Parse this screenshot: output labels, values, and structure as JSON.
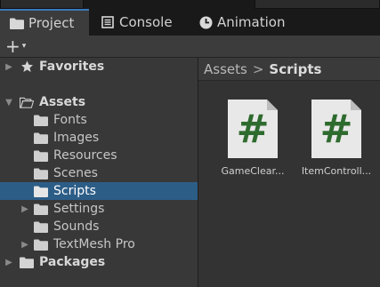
{
  "tabs": [
    {
      "label": "Project",
      "icon": "folder-icon",
      "active": true
    },
    {
      "label": "Console",
      "icon": "console-icon",
      "active": false
    },
    {
      "label": "Animation",
      "icon": "clock-icon",
      "active": false
    }
  ],
  "toolbar": {
    "add_label": "+",
    "add_caret": "▾"
  },
  "tree": {
    "favorites": "Favorites",
    "assets": "Assets",
    "fonts": "Fonts",
    "images": "Images",
    "resources": "Resources",
    "scenes": "Scenes",
    "scripts": "Scripts",
    "settings": "Settings",
    "sounds": "Sounds",
    "textmeshpro": "TextMesh Pro",
    "packages": "Packages",
    "selected": "Scripts"
  },
  "breadcrumb": {
    "root": "Assets",
    "separator": ">",
    "current": "Scripts"
  },
  "files": [
    {
      "name": "GameClear...",
      "glyph": "#"
    },
    {
      "name": "ItemControll...",
      "glyph": "#"
    }
  ],
  "colors": {
    "selection": "#2c5d87",
    "script_hash": "#2e6b2e",
    "tab_accent": "#3a79bb"
  }
}
